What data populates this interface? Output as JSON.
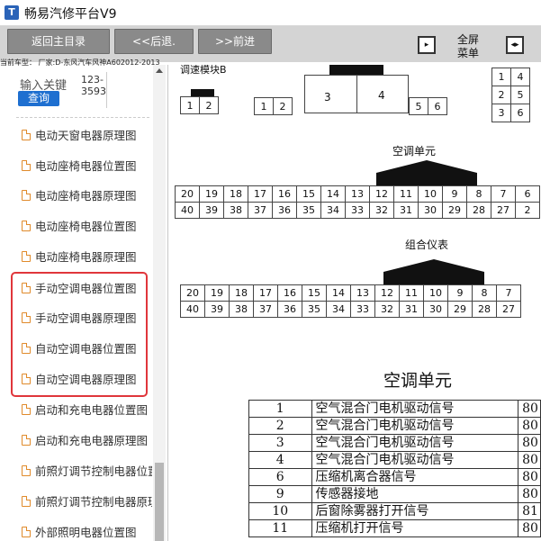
{
  "app": {
    "title": "畅易汽修平台V9",
    "icon": "app-logo-icon"
  },
  "toolbar": {
    "home_label": "返回主目录",
    "back_label": "<<后退.",
    "forward_label": ">>前进",
    "fullscreen_label": "全屏",
    "menu_label": "菜单"
  },
  "vehicle_info": "当前车型： 厂家:D-东风汽车风神A602012-2013",
  "sidebar": {
    "search_placeholder": "输入关键",
    "search_button": "查询",
    "codes": [
      "123-",
      "3593"
    ],
    "items": [
      {
        "label": "电动天窗电器原理图"
      },
      {
        "label": "电动座椅电器位置图"
      },
      {
        "label": "电动座椅电器原理图"
      },
      {
        "label": "电动座椅电器位置图"
      },
      {
        "label": "电动座椅电器原理图"
      },
      {
        "label": "手动空调电器位置图"
      },
      {
        "label": "手动空调电器原理图"
      },
      {
        "label": "自动空调电器位置图"
      },
      {
        "label": "自动空调电器原理图"
      },
      {
        "label": "启动和充电电器位置图"
      },
      {
        "label": "启动和充电电器原理图"
      },
      {
        "label": "前照灯调节控制电器位置图"
      },
      {
        "label": "前照灯调节控制电器原理图"
      },
      {
        "label": "外部照明电器位置图"
      }
    ]
  },
  "document": {
    "top_fragment": "调速模块B",
    "top_small_pins": [
      "1",
      "2"
    ],
    "top_pins": [
      "1",
      "2",
      "3",
      "4",
      "5",
      "6"
    ],
    "right_grid": [
      [
        "1",
        "4"
      ],
      [
        "2",
        "5"
      ],
      [
        "3",
        "6"
      ]
    ],
    "connector1": {
      "title": "空调单元",
      "row1": [
        "20",
        "19",
        "18",
        "17",
        "16",
        "15",
        "14",
        "13",
        "12",
        "11",
        "10",
        "9",
        "8",
        "7",
        "6"
      ],
      "row2": [
        "40",
        "39",
        "38",
        "37",
        "36",
        "35",
        "34",
        "33",
        "32",
        "31",
        "30",
        "29",
        "28",
        "27",
        "2"
      ]
    },
    "connector2": {
      "title": "组合仪表",
      "row1": [
        "20",
        "19",
        "18",
        "17",
        "16",
        "15",
        "14",
        "13",
        "12",
        "11",
        "10",
        "9",
        "8",
        "7"
      ],
      "row2": [
        "40",
        "39",
        "38",
        "37",
        "36",
        "35",
        "34",
        "33",
        "32",
        "31",
        "30",
        "29",
        "28",
        "27"
      ]
    },
    "table_title": "空调单元",
    "table_rows": [
      {
        "pin": "1",
        "desc": "空气混合门电机驱动信号",
        "color": "80"
      },
      {
        "pin": "2",
        "desc": "空气混合门电机驱动信号",
        "color": "80"
      },
      {
        "pin": "3",
        "desc": "空气混合门电机驱动信号",
        "color": "80"
      },
      {
        "pin": "4",
        "desc": "空气混合门电机驱动信号",
        "color": "80"
      },
      {
        "pin": "6",
        "desc": "压缩机离合器信号",
        "color": "80"
      },
      {
        "pin": "9",
        "desc": "传感器接地",
        "color": "80"
      },
      {
        "pin": "10",
        "desc": "后窗除雾器打开信号",
        "color": "81"
      },
      {
        "pin": "11",
        "desc": "压缩机打开信号",
        "color": "80"
      }
    ]
  },
  "colors": {
    "accent": "#1e6fd0",
    "highlight": "#e0363b",
    "toolbar_button": "#8a8a8a"
  }
}
